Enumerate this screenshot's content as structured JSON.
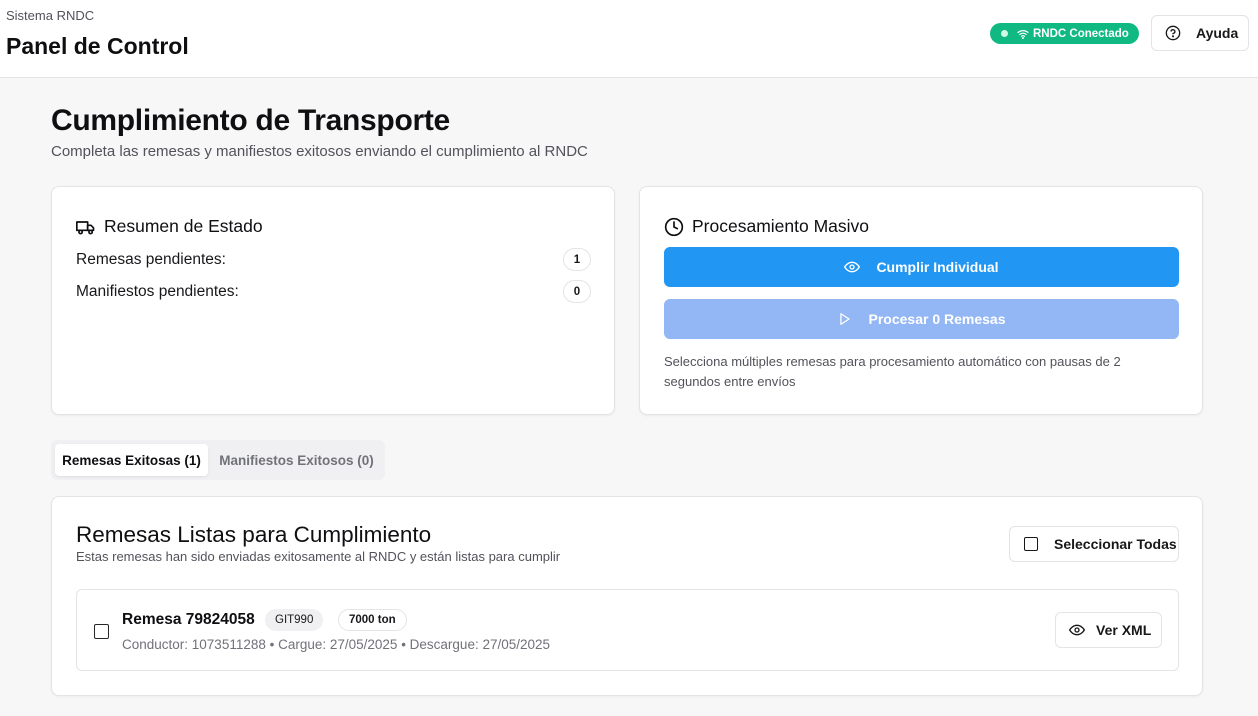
{
  "header": {
    "subtitle": "Sistema RNDC",
    "title": "Panel de Control",
    "status_label": "RNDC Conectado",
    "help_label": "Ayuda",
    "icons": {
      "status": "wifi-icon",
      "help": "help-circle-icon"
    }
  },
  "page": {
    "title": "Cumplimiento de Transporte",
    "description": "Completa las remesas y manifiestos exitosos enviando el cumplimiento al RNDC"
  },
  "summary": {
    "title": "Resumen de Estado",
    "icon": "truck-icon",
    "rows": [
      {
        "label": "Remesas pendientes:",
        "count": "1"
      },
      {
        "label": "Manifiestos pendientes:",
        "count": "0"
      }
    ]
  },
  "bulk": {
    "title": "Procesamiento Masivo",
    "icon": "clock-icon",
    "individual_label": "Cumplir Individual",
    "process_label": "Procesar 0 Remesas",
    "note": "Selecciona múltiples remesas para procesamiento automático con pausas de 2 segundos entre envíos"
  },
  "tabs": [
    {
      "label": "Remesas Exitosas (1)",
      "active": true
    },
    {
      "label": "Manifiestos Exitosos (0)",
      "active": false
    }
  ],
  "list": {
    "title": "Remesas Listas para Cumplimiento",
    "description": "Estas remesas han sido enviadas exitosamente al RNDC y están listas para cumplir",
    "select_all_label": "Seleccionar Todas",
    "items": [
      {
        "title": "Remesa 79824058",
        "plate": "GIT990",
        "weight": "7000 ton",
        "meta": "Conductor: 1073511288 • Cargue: 27/05/2025 • Descargue: 27/05/2025",
        "xml_label": "Ver XML"
      }
    ]
  },
  "colors": {
    "status_green": "#10b981",
    "primary_blue": "#2196f3",
    "disabled_blue": "#93b6f5"
  }
}
